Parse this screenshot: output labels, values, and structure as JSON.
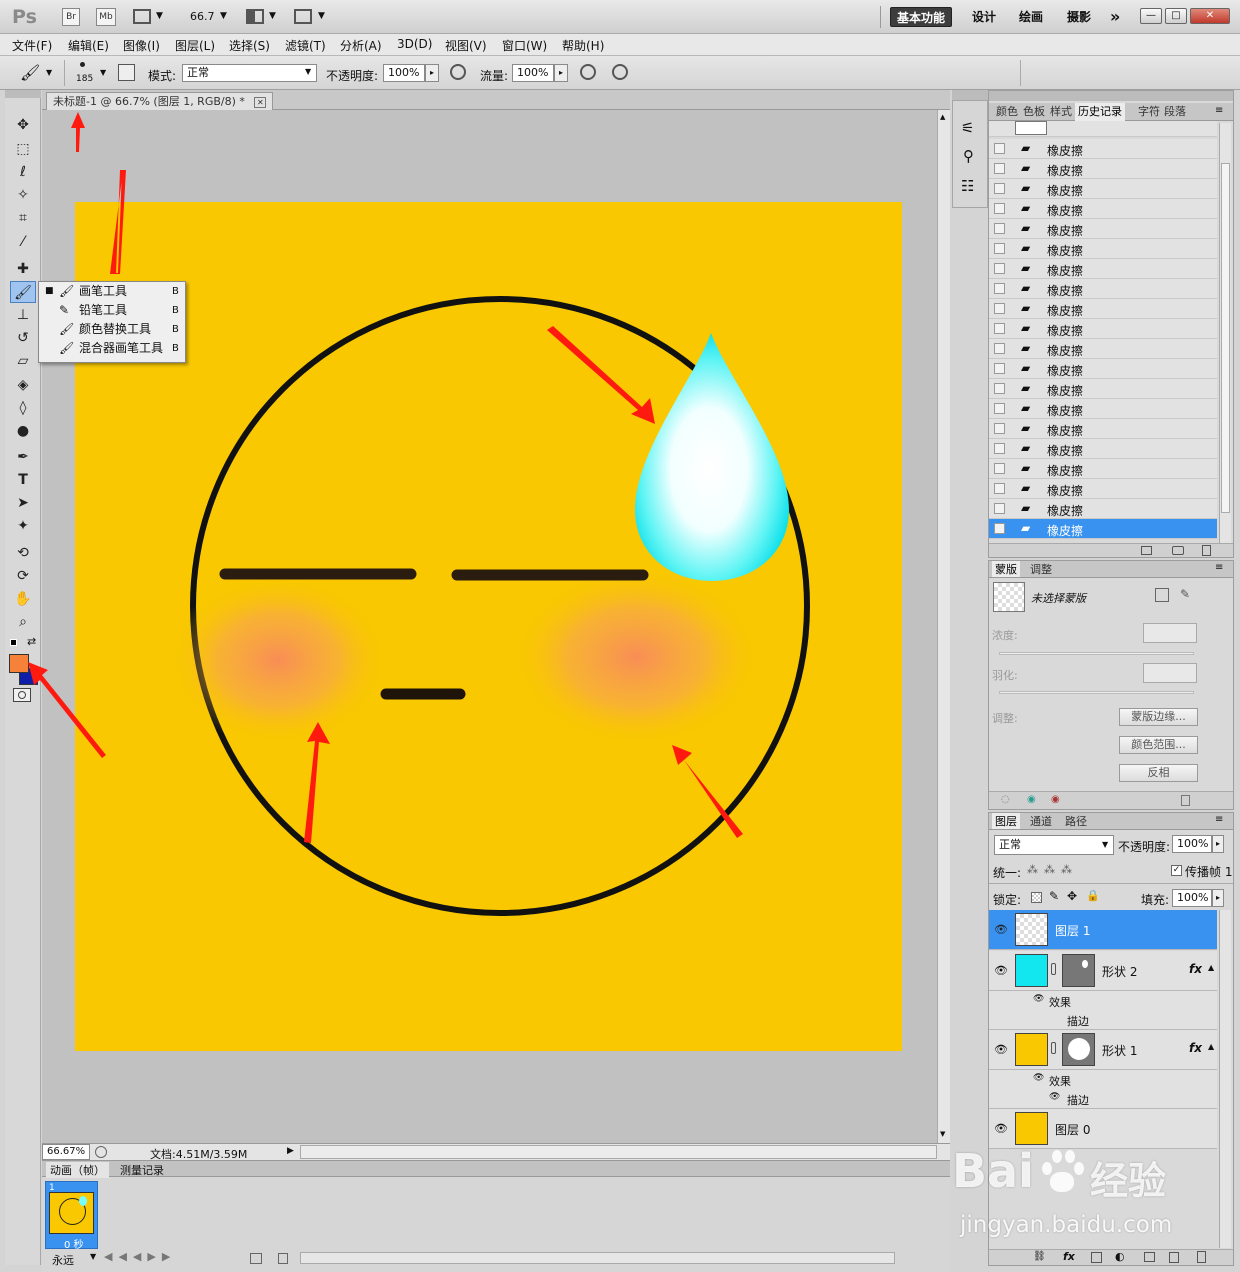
{
  "app": {
    "logo": "Ps",
    "bridge": "Br",
    "minibridge": "Mb",
    "zoom": "66.7"
  },
  "workspaces": [
    "基本功能",
    "设计",
    "绘画",
    "摄影",
    "»"
  ],
  "window_controls": [
    "—",
    "□",
    "✕"
  ],
  "menu": [
    "文件(F)",
    "编辑(E)",
    "图像(I)",
    "图层(L)",
    "选择(S)",
    "滤镜(T)",
    "分析(A)",
    "3D(D)",
    "视图(V)",
    "窗口(W)",
    "帮助(H)"
  ],
  "options": {
    "brush_size": "185",
    "mode_label": "模式:",
    "mode_value": "正常",
    "opacity_label": "不透明度:",
    "opacity_value": "100%",
    "flow_label": "流量:",
    "flow_value": "100%"
  },
  "document": {
    "tab_title": "未标题-1 @ 66.7% (图层 1, RGB/8) *",
    "close": "✕",
    "status_zoom": "66.67%",
    "status_doc": "文档:4.51M/3.59M"
  },
  "flyout": {
    "items": [
      {
        "label": "画笔工具",
        "key": "B",
        "selected": true
      },
      {
        "label": "铅笔工具",
        "key": "B",
        "selected": false
      },
      {
        "label": "颜色替换工具",
        "key": "B",
        "selected": false
      },
      {
        "label": "混合器画笔工具",
        "key": "B",
        "selected": false
      }
    ]
  },
  "colors": {
    "foreground": "#f6823a",
    "background": "#0f1ea8",
    "canvas_bg": "#f9c800",
    "selection": "#3a92f0"
  },
  "history": {
    "tabs": [
      "颜色",
      "色板",
      "样式",
      "历史记录",
      "字符",
      "段落"
    ],
    "items": [
      "橡皮擦",
      "橡皮擦",
      "橡皮擦",
      "橡皮擦",
      "橡皮擦",
      "橡皮擦",
      "橡皮擦",
      "橡皮擦",
      "橡皮擦",
      "橡皮擦",
      "橡皮擦",
      "橡皮擦",
      "橡皮擦",
      "橡皮擦",
      "橡皮擦",
      "橡皮擦",
      "橡皮擦",
      "橡皮擦",
      "橡皮擦",
      "橡皮擦"
    ]
  },
  "masks": {
    "tabs": [
      "蒙版",
      "调整"
    ],
    "no_mask": "未选择蒙版",
    "density": "浓度:",
    "feather": "羽化:",
    "adjust": "调整:",
    "btn_edge": "蒙版边缘...",
    "btn_range": "颜色范围...",
    "btn_invert": "反相"
  },
  "layers": {
    "tabs": [
      "图层",
      "通道",
      "路径"
    ],
    "blend": "正常",
    "opacity_label": "不透明度:",
    "opacity_value": "100%",
    "unify_label": "统一:",
    "propagate": "传播帧 1",
    "lock_label": "锁定:",
    "fill_label": "填充:",
    "fill_value": "100%",
    "layer1": "图层 1",
    "shape2": "形状 2",
    "shape1": "形状 1",
    "effects": "效果",
    "stroke": "描边",
    "layer0": "图层 0",
    "fx": "fx"
  },
  "animation": {
    "tabs": [
      "动画（帧）",
      "测量记录"
    ],
    "frame_no": "1",
    "frame_time": "0 秒",
    "loop": "永远"
  },
  "watermark": {
    "brand": "Bai",
    "brand2": "经验",
    "url": "jingyan.baidu.com"
  }
}
